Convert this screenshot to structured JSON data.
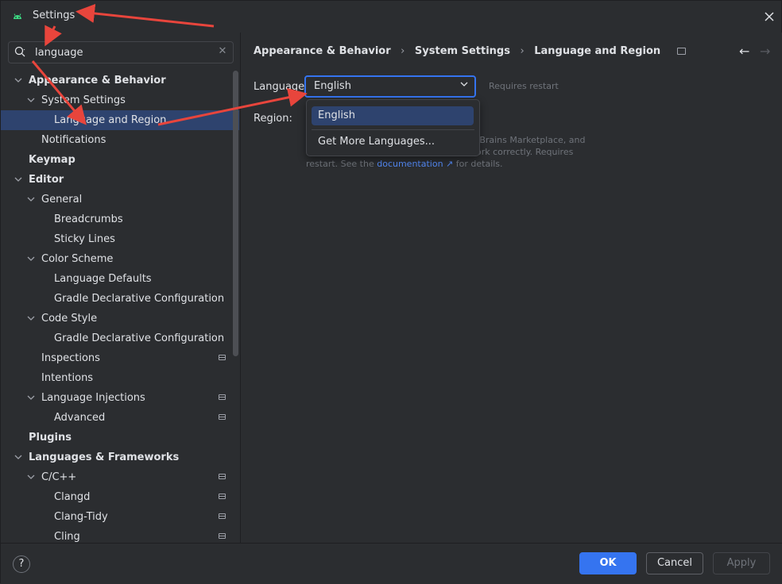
{
  "window": {
    "title": "Settings",
    "brand_color": "#3ddc84"
  },
  "search": {
    "value": "language",
    "placeholder": ""
  },
  "tree": [
    {
      "label": "Appearance & Behavior",
      "level": 0,
      "chevron": "down",
      "bold": true
    },
    {
      "label": "System Settings",
      "level": 1,
      "chevron": "down"
    },
    {
      "label": "Language and Region",
      "level": 2,
      "selected": true
    },
    {
      "label": "Notifications",
      "level": 1
    },
    {
      "label": "Keymap",
      "level": 0,
      "bold": true
    },
    {
      "label": "Editor",
      "level": 0,
      "chevron": "down",
      "bold": true
    },
    {
      "label": "General",
      "level": 1,
      "chevron": "down"
    },
    {
      "label": "Breadcrumbs",
      "level": 2
    },
    {
      "label": "Sticky Lines",
      "level": 2
    },
    {
      "label": "Color Scheme",
      "level": 1,
      "chevron": "down"
    },
    {
      "label": "Language Defaults",
      "level": 2
    },
    {
      "label": "Gradle Declarative Configuration Lang",
      "level": 2
    },
    {
      "label": "Code Style",
      "level": 1,
      "chevron": "down"
    },
    {
      "label": "Gradle Declarative Configuration Lang",
      "level": 2
    },
    {
      "label": "Inspections",
      "level": 1,
      "module_icon": true
    },
    {
      "label": "Intentions",
      "level": 1
    },
    {
      "label": "Language Injections",
      "level": 1,
      "chevron": "down",
      "module_icon": true
    },
    {
      "label": "Advanced",
      "level": 2,
      "module_icon": true
    },
    {
      "label": "Plugins",
      "level": 0,
      "bold": true
    },
    {
      "label": "Languages & Frameworks",
      "level": 0,
      "chevron": "down",
      "bold": true
    },
    {
      "label": "C/C++",
      "level": 1,
      "chevron": "down",
      "module_icon": true
    },
    {
      "label": "Clangd",
      "level": 2,
      "module_icon": true
    },
    {
      "label": "Clang-Tidy",
      "level": 2,
      "module_icon": true
    },
    {
      "label": "Cling",
      "level": 2,
      "module_icon": true
    }
  ],
  "breadcrumb": [
    "Appearance & Behavior",
    "System Settings",
    "Language and Region"
  ],
  "form": {
    "language_label": "Language:",
    "language_value": "English",
    "requires_restart": "Requires restart",
    "region_label": "Region:",
    "help_visible_1": "tBrains Marketplace, and",
    "help_visible_2": "ork correctly. Requires",
    "help_prefix_3": "restart. See the ",
    "help_link": "documentation",
    "help_link_icon": "↗",
    "help_suffix_3": " for details."
  },
  "dropdown": {
    "options": [
      "English",
      "Get More Languages..."
    ],
    "selected": "English"
  },
  "footer": {
    "help": "?",
    "ok": "OK",
    "cancel": "Cancel",
    "apply": "Apply"
  },
  "colors": {
    "accent": "#3574f0",
    "selection": "#2e436e",
    "annotation_arrow": "#e8453c"
  }
}
